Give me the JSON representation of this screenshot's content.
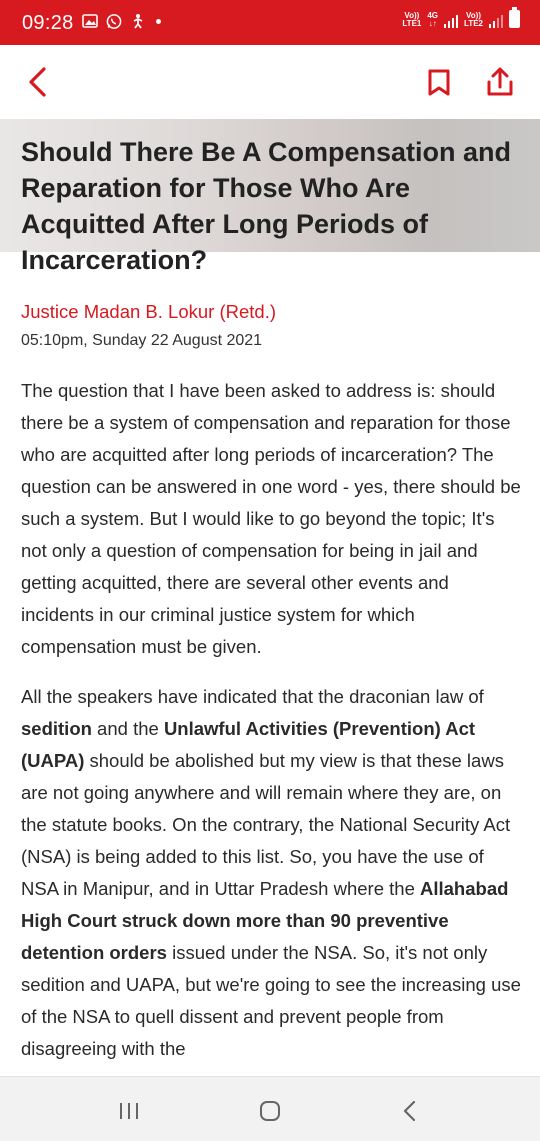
{
  "status_bar": {
    "time": "09:28",
    "left_icons": [
      "gallery-icon",
      "whatsapp-icon",
      "accessibility-icon",
      "notification-dot"
    ],
    "sim1_label_top": "Vo))",
    "sim1_label_bottom": "LTE1",
    "network_label": "4G",
    "sim2_label_top": "Vo))",
    "sim2_label_bottom": "LTE2",
    "background_color": "#d71920"
  },
  "app_bar": {
    "back_icon": "chevron-left-icon",
    "bookmark_icon": "bookmark-icon",
    "share_icon": "share-icon",
    "accent_color": "#d71920"
  },
  "article": {
    "title": "Should There Be A Compensation and Reparation for Those Who Are Acquitted After Long Periods of Incarceration?",
    "author": "Justice Madan B. Lokur (Retd.)",
    "date": "05:10pm,  Sunday 22 August 2021",
    "paragraph1": "The question that I have been asked to address is: should there be a system of compensation and reparation for those who are acquitted after long periods of incarceration? The question can be answered in one word - yes, there should be such a system. But I would like to go beyond the topic; It's not only a question of compensation for being in jail and getting acquitted, there are several other events and incidents in our criminal justice system for which compensation must be given.",
    "p2_a": "All the speakers have indicated that the draconian law of ",
    "p2_b_bold": "sedition",
    "p2_c": " and the ",
    "p2_d_bold": "Unlawful Activities (Prevention) Act (UAPA)",
    "p2_e": " should be abolished but my view is that these laws are not going anywhere and will remain where they are, on the statute books. On the contrary, the National Security Act (NSA) is being added to this list. So, you have the use of NSA in Manipur, and in Uttar Pradesh where the ",
    "p2_f_bold": "Allahabad High Court struck down more than 90 preventive detention orders",
    "p2_g": " issued under the NSA. So, it's not only sedition and UAPA, but we're going to see the increasing use of the NSA to quell dissent and prevent people from disagreeing with the"
  },
  "nav_bar": {
    "recent_icon": "recent-apps-icon",
    "home_icon": "home-icon",
    "back_icon": "back-icon"
  }
}
